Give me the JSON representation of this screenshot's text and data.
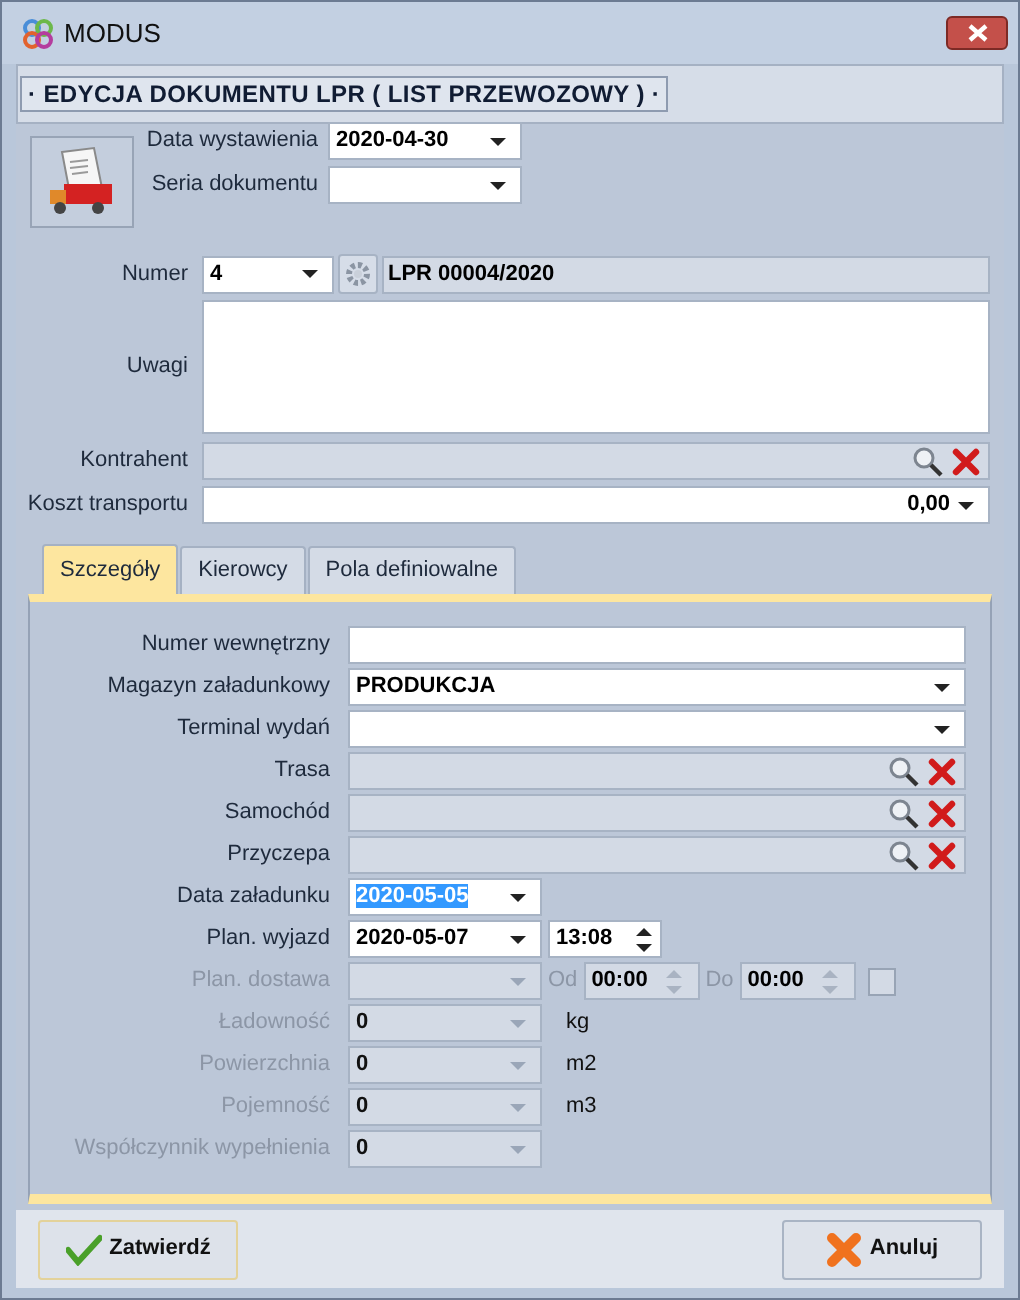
{
  "window": {
    "title": "MODUS"
  },
  "header": {
    "title": "· EDYCJA DOKUMENTU LPR ( LIST PRZEWOZOWY ) ·"
  },
  "document": {
    "issue_date": {
      "label": "Data wystawienia",
      "value": "2020-04-30"
    },
    "series": {
      "label": "Seria dokumentu"
    },
    "number": {
      "label": "Numer",
      "value": "4",
      "full": "LPR 00004/2020"
    },
    "notes": {
      "label": "Uwagi"
    },
    "contractor": {
      "label": "Kontrahent"
    },
    "transport_cost": {
      "label": "Koszt transportu",
      "value": "0,00"
    }
  },
  "tabs": [
    {
      "label": "Szczegóły",
      "selected": true
    },
    {
      "label": "Kierowcy",
      "selected": false
    },
    {
      "label": "Pola definiowalne",
      "selected": false
    }
  ],
  "details": [
    {
      "kind": "text",
      "label": "Numer wewnętrzny",
      "disabled": false
    },
    {
      "kind": "dropdown",
      "label": "Magazyn załadunkowy",
      "value": "PRODUKCJA",
      "disabled": false
    },
    {
      "kind": "dropdown",
      "label": "Terminal wydań",
      "disabled": false
    },
    {
      "kind": "lookup",
      "label": "Trasa",
      "disabled": false
    },
    {
      "kind": "lookup",
      "label": "Samochód",
      "disabled": false
    },
    {
      "kind": "lookup",
      "label": "Przyczepa",
      "disabled": false
    },
    {
      "kind": "date",
      "label": "Data załadunku",
      "value": "2020-05-05",
      "value_selected": true,
      "disabled": false
    },
    {
      "kind": "datetime",
      "label": "Plan. wyjazd",
      "value": "2020-05-07",
      "time": "13:08",
      "value_selected": false,
      "disabled": false
    },
    {
      "kind": "range",
      "label": "Plan. dostawa",
      "from_label": "Od",
      "from": "00:00",
      "to_label": "Do",
      "to": "00:00",
      "checked": false,
      "disabled": true
    },
    {
      "kind": "measure",
      "label": "Ładowność",
      "value": "0",
      "unit": "kg",
      "disabled": true
    },
    {
      "kind": "measure",
      "label": "Powierzchnia",
      "value": "0",
      "unit": "m2",
      "disabled": true
    },
    {
      "kind": "measure",
      "label": "Pojemność",
      "value": "0",
      "unit": "m3",
      "disabled": true
    },
    {
      "kind": "measure",
      "label": "Współczynnik wypełnienia",
      "value": "0",
      "disabled": true
    }
  ],
  "buttons": [
    {
      "kind": "confirm",
      "label": "Zatwierdź"
    },
    {
      "kind": "cancel",
      "label": "Anuluj"
    }
  ]
}
